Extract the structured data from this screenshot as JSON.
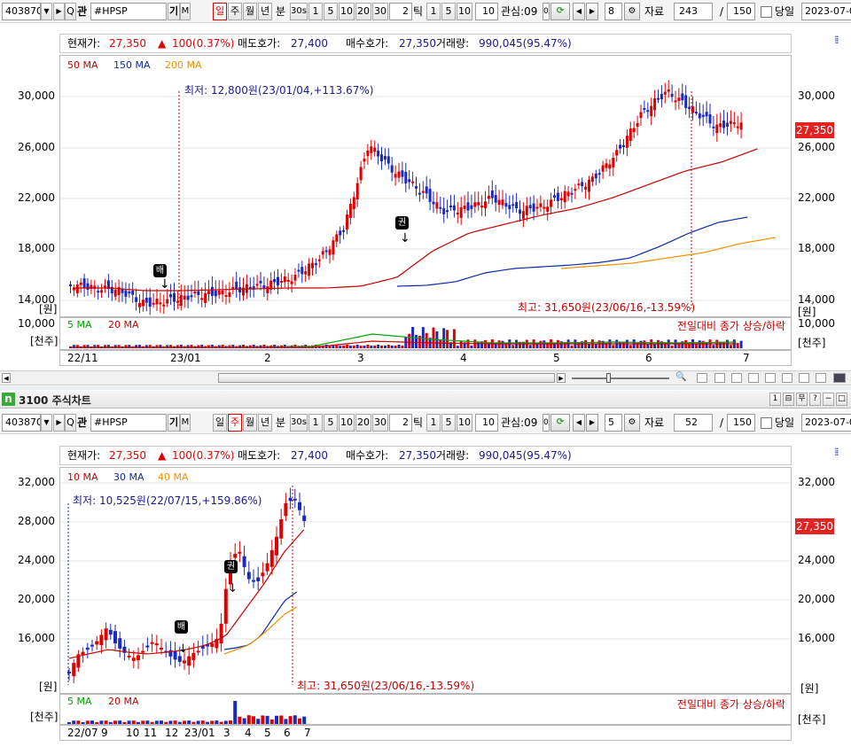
{
  "top_toolbar": {
    "code": "403870",
    "name_prefix": "관",
    "symbol": "#HPSP",
    "gi": "기",
    "m": "M",
    "periods": [
      "일",
      "주",
      "월",
      "년"
    ],
    "active_period": "일",
    "unit_label": "분",
    "minute_buttons": [
      "30s",
      "1",
      "5",
      "10",
      "20",
      "30"
    ],
    "tick_value": "2",
    "tick_label": "틱",
    "tick_buttons": [
      "1",
      "5",
      "10"
    ],
    "tick_input": "10",
    "interest_label": "관심:09",
    "interest_value": "0",
    "count_value": "8",
    "data_label": "자료",
    "data_count": "243",
    "slash": "/",
    "total": "150",
    "same_day_label": "당일",
    "date": "2023-07-0"
  },
  "top_chart": {
    "header": {
      "cur_label": "현재가:",
      "cur_value": "27,350",
      "chg_arrow": "▲",
      "chg_value": "100(0.37%)",
      "ask_label": "매도호가:",
      "ask_value": "27,400",
      "bid_label": "매수호가:",
      "bid_value": "27,350",
      "vol_label": "거래량:",
      "vol_value": "990,045(95.47%)"
    },
    "legend": [
      {
        "label": "50 MA",
        "color": "#c80000"
      },
      {
        "label": "150 MA",
        "color": "#0a2aa0"
      },
      {
        "label": "200 MA",
        "color": "#f09000"
      }
    ],
    "y_ticks": [
      "30,000",
      "26,000",
      "22,000",
      "18,000",
      "14,000"
    ],
    "y_unit": "[원]",
    "low_note": "최저: 12,800원(23/01/04,+113.67%)",
    "high_note": "최고: 31,650원(23/06/16,-13.59%)",
    "price_tag": "27,350",
    "badge1": "배",
    "badge2": "권",
    "vol_legend": [
      {
        "label": "5 MA",
        "color": "#00a000"
      },
      {
        "label": "20 MA",
        "color": "#c80000"
      }
    ],
    "vol_note": "전일대비 종가 상승/하락",
    "vol_y": "10,000",
    "vol_unit": "[천주]",
    "x_labels": [
      "22/11",
      "23/01",
      "2",
      "3",
      "4",
      "5",
      "6",
      "7"
    ]
  },
  "window_title": {
    "icon": "n",
    "text": "3100 주식차트",
    "controls": [
      "1",
      "⊟",
      "무",
      "?",
      "−",
      "□"
    ]
  },
  "bottom_toolbar": {
    "code": "403870",
    "name_prefix": "관",
    "symbol": "#HPSP",
    "gi": "기",
    "m": "M",
    "periods": [
      "일",
      "주",
      "월",
      "년"
    ],
    "active_period": "주",
    "unit_label": "분",
    "minute_buttons": [
      "30s",
      "1",
      "5",
      "10",
      "20",
      "30"
    ],
    "tick_value": "2",
    "tick_label": "틱",
    "tick_buttons": [
      "1",
      "5",
      "10"
    ],
    "tick_input": "10",
    "interest_label": "관심:09",
    "interest_value": "0",
    "count_value": "5",
    "data_label": "자료",
    "data_count": "52",
    "slash": "/",
    "total": "150",
    "same_day_label": "당일",
    "date": "2023-07-0"
  },
  "bottom_chart": {
    "header": {
      "cur_label": "현재가:",
      "cur_value": "27,350",
      "chg_arrow": "▲",
      "chg_value": "100(0.37%)",
      "ask_label": "매도호가:",
      "ask_value": "27,400",
      "bid_label": "매수호가:",
      "bid_value": "27,350",
      "vol_label": "거래량:",
      "vol_value": "990,045(95.47%)"
    },
    "legend": [
      {
        "label": "10 MA",
        "color": "#c80000"
      },
      {
        "label": "30 MA",
        "color": "#0a2aa0"
      },
      {
        "label": "40 MA",
        "color": "#f09000"
      }
    ],
    "y_ticks": [
      "32,000",
      "28,000",
      "24,000",
      "20,000",
      "16,000"
    ],
    "y_unit": "[원]",
    "low_note": "최저: 10,525원(22/07/15,+159.86%)",
    "high_note": "최고: 31,650원(23/06/16,-13.59%)",
    "price_tag": "27,350",
    "badge1": "배",
    "badge2": "권",
    "vol_legend": [
      {
        "label": "5 MA",
        "color": "#00a000"
      },
      {
        "label": "20 MA",
        "color": "#c80000"
      }
    ],
    "vol_note": "전일대비 종가 상승/하락",
    "vol_unit": "[천주]",
    "x_labels": [
      "22/07",
      "9",
      "10",
      "11",
      "12",
      "23/01",
      "3",
      "4",
      "5",
      "6",
      "7"
    ]
  }
}
